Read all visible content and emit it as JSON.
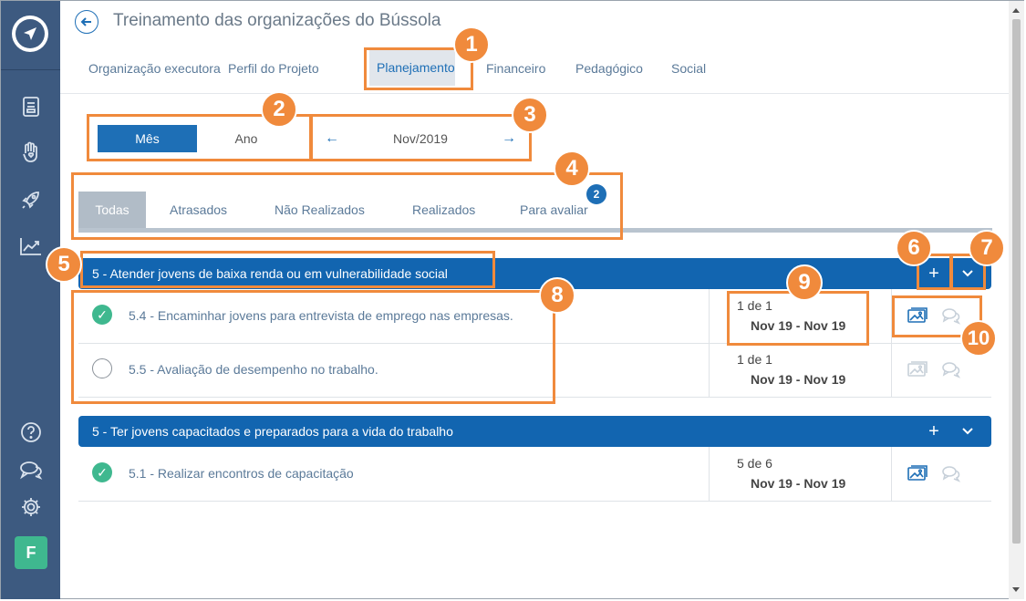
{
  "window": {
    "title": "Treinamento das organizações do Bússola"
  },
  "sidebar": {
    "icons": [
      "compass-logo-icon",
      "document-icon",
      "hand-heart-icon",
      "rocket-icon",
      "chart-line-icon",
      "help-icon",
      "chat-icon",
      "gear-icon"
    ],
    "avatar_letter": "F",
    "avatar_color": "#3fb88f"
  },
  "nav": {
    "tabs": [
      "Organização executora",
      "Perfil do Projeto",
      "Planejamento",
      "Financeiro",
      "Pedagógico",
      "Social"
    ],
    "active": "Planejamento"
  },
  "period": {
    "mes": "Mês",
    "ano": "Ano",
    "selected": "Mês",
    "current": "Nov/2019"
  },
  "filters": {
    "tabs": [
      "Todas",
      "Atrasados",
      "Não Realizados",
      "Realizados",
      "Para avaliar"
    ],
    "active": "Todas",
    "para_avaliar_badge": "2"
  },
  "goals": [
    {
      "title": "5 - Atender jovens de baixa renda ou em vulnerabilidade social",
      "tasks": [
        {
          "label": "5.4 - Encaminhar jovens para entrevista de emprego nas empresas.",
          "done": true,
          "count": "1 de 1",
          "range": "Nov 19 - Nov 19"
        },
        {
          "label": "5.5 - Avaliação de desempenho no trabalho.",
          "done": false,
          "count": "1 de 1",
          "range": "Nov 19 - Nov 19"
        }
      ]
    },
    {
      "title": "5 - Ter jovens capacitados e preparados para a vida do trabalho",
      "tasks": [
        {
          "label": "5.1 - Realizar encontros de capacitação",
          "done": true,
          "count": "5 de 6",
          "range": "Nov 19 - Nov 19"
        }
      ]
    }
  ],
  "annotations": [
    "1",
    "2",
    "3",
    "4",
    "5",
    "6",
    "7",
    "8",
    "9",
    "10"
  ],
  "colors": {
    "primary": "#1265b0",
    "accent": "#f08a3c",
    "sidebar": "#3d5a80",
    "success": "#3fb88f"
  }
}
